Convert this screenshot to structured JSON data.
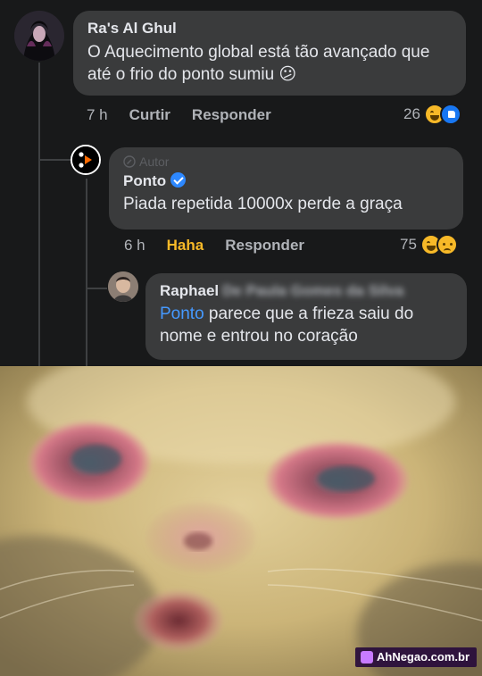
{
  "comments": [
    {
      "author": "Ra's Al Ghul",
      "text": "O Aquecimento global está tão avançado que até o frio do ponto sumiu 😕",
      "time": "7 h",
      "actions": [
        "Curtir",
        "Responder"
      ],
      "reaction_count": "26",
      "reactions": [
        "haha",
        "like"
      ]
    },
    {
      "badge": "Autor",
      "author": "Ponto",
      "verified": true,
      "text": "Piada repetida 10000x perde a graça",
      "time": "6 h",
      "actions": [
        "Haha",
        "Responder"
      ],
      "reaction_count": "75",
      "reactions": [
        "haha",
        "sad"
      ]
    },
    {
      "author": "Raphael",
      "author_blurred_suffix": "De Paula Gomes da Silva",
      "mention": "Ponto",
      "text": " parece que a frieza saiu do nome e entrou no coração"
    }
  ],
  "watermark": "AhNegao.com.br",
  "colors": {
    "background": "#18191a",
    "bubble": "#3a3b3c",
    "text": "#e4e6eb",
    "muted": "#b0b3b8",
    "link": "#4599ff",
    "haha": "#f7b928"
  }
}
